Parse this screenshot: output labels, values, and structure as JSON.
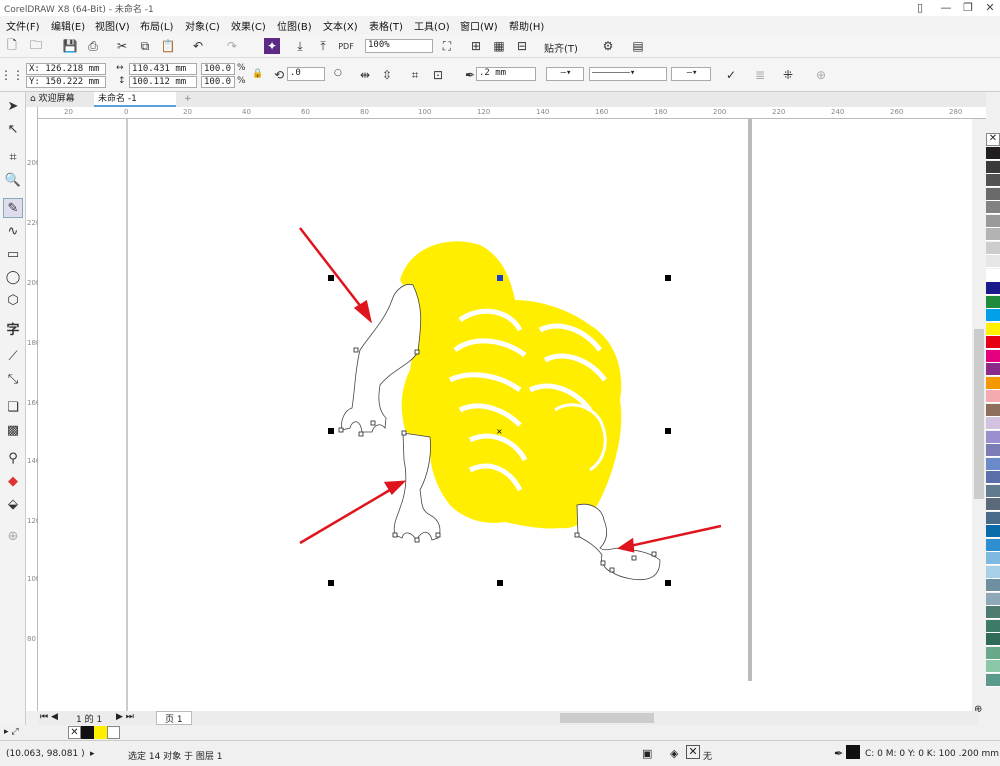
{
  "title": "CorelDRAW X8 (64-Bit) - 未命名 -1",
  "menu": [
    "文件(F)",
    "编辑(E)",
    "视图(V)",
    "布局(L)",
    "对象(C)",
    "效果(C)",
    "位图(B)",
    "文本(X)",
    "表格(T)",
    "工具(O)",
    "窗口(W)",
    "帮助(H)"
  ],
  "toolbar": {
    "zoom": "100%",
    "snap": "贴齐(T)"
  },
  "props": {
    "x": "X: 126.218 mm",
    "y": "Y: 150.222 mm",
    "w": "110.431 mm",
    "h": "100.112 mm",
    "sx": "100.0",
    "sy": "100.0",
    "pct": "%",
    "angle": ".0",
    "outline": ".2 mm"
  },
  "tabs": {
    "welcome": "欢迎屏幕",
    "doc": "未命名 -1"
  },
  "hruler": [
    "20",
    "0",
    "20",
    "40",
    "60",
    "80",
    "100",
    "120",
    "140",
    "160",
    "180",
    "200",
    "220",
    "240",
    "260",
    "280"
  ],
  "vruler": [
    "200",
    "220",
    "200",
    "180",
    "160",
    "140",
    "120",
    "100",
    "80"
  ],
  "pagebar": {
    "pageof": "1 的 1",
    "page": "页 1"
  },
  "status": {
    "coords": "(10.063, 98.081 )",
    "selection": "选定 14 对象 于 图层 1",
    "fill": "无",
    "outline": "C: 0 M: 0 Y: 0 K: 100  .200 mm"
  },
  "colors": {
    "lion": "#ffee00",
    "arrow": "#e0141c"
  },
  "palette": [
    "#231f20",
    "#3a3a3a",
    "#525252",
    "#6a6a6a",
    "#828282",
    "#9a9a9a",
    "#b3b3b3",
    "#cccccc",
    "#e6e6e6",
    "#ffffff",
    "#1c1a8a",
    "#1f8a3c",
    "#00a0e9",
    "#fff100",
    "#e60012",
    "#e4007f",
    "#8a2a8a",
    "#f39800",
    "#f5a9b0",
    "#8e6e5c",
    "#d3c3e0",
    "#9c8fcf",
    "#7b7bb5",
    "#6a8ac8",
    "#5b6fa8",
    "#607a8e",
    "#5a6a7a",
    "#4a6a8a",
    "#0b6aa8",
    "#2d8fcf",
    "#7fb8e0",
    "#a8d0e8",
    "#6d8fa0",
    "#8ea8b8",
    "#4f7a70",
    "#3d7a68",
    "#2f6a5a",
    "#6aa88a",
    "#8ac8a8",
    "#5a9a8a"
  ]
}
